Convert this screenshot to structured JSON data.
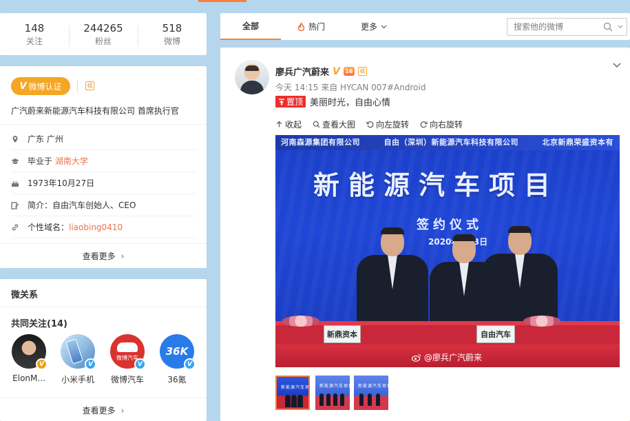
{
  "stats": [
    {
      "value": "148",
      "label": "关注"
    },
    {
      "value": "244265",
      "label": "粉丝"
    },
    {
      "value": "518",
      "label": "微博"
    }
  ],
  "profile": {
    "verify_button": "微博认证",
    "verify_icon": "V",
    "tag_badge": "橘",
    "verify_text": "广汽蔚来新能源汽车科技有限公司 首席执行官",
    "location": "广东 广州",
    "education_prefix": "毕业于",
    "education_school": "湖南大学",
    "birthday": "1973年10月27日",
    "intro_label": "简介：",
    "intro_value": "自由汽车创始人、CEO",
    "domain_label": "个性域名：",
    "domain_value": "liaobing0410",
    "more": "查看更多"
  },
  "relations": {
    "title": "微关系",
    "common_follow": "共同关注(14)",
    "friends": [
      {
        "name": "ElonM...",
        "badge": "V",
        "badge_color": "#f0a21b"
      },
      {
        "name": "小米手机",
        "badge": "V",
        "badge_color": "#3aa4f0"
      },
      {
        "name": "微博汽车",
        "badge": "V",
        "badge_color": "#3aa4f0",
        "avatar_text": "微博汽车"
      },
      {
        "name": "36氪",
        "badge": "V",
        "badge_color": "#3aa4f0",
        "avatar_text": "36K"
      }
    ],
    "more": "查看更多"
  },
  "tabs": {
    "all": "全部",
    "hot": "热门",
    "more": "更多",
    "search_placeholder": "搜索他的微博"
  },
  "post": {
    "author": "廖兵广汽蔚来",
    "vip_v": "V",
    "crown_label": "16",
    "tag_badge": "橘",
    "meta": "今天 14:15 来自 HYCAN 007#Android",
    "pin_label": "置顶",
    "content": "美丽时光，自由心情",
    "actions": {
      "collapse": "收起",
      "view_large": "查看大图",
      "rotate_left": "向左旋转",
      "rotate_right": "向右旋转"
    },
    "photo": {
      "header_text": "河南森源集团有限公司　　　自由（深圳）新能源汽车科技有限公司　　　北京新鼎荣盛资本有",
      "headline": "新能源汽车项目",
      "subline": "签约仪式",
      "date": "2020年3月3日",
      "nameplate_left": "新鼎资本",
      "nameplate_center": "自由汽车",
      "watermark": "@廖兵广汽蔚来"
    },
    "thumb_text": "新能源汽车项目"
  },
  "colors": {
    "accent": "#fa7d3c",
    "background": "#b5d6ec",
    "link": "#eb7350",
    "pin": "#e9302c",
    "gold": "#f5a623"
  }
}
